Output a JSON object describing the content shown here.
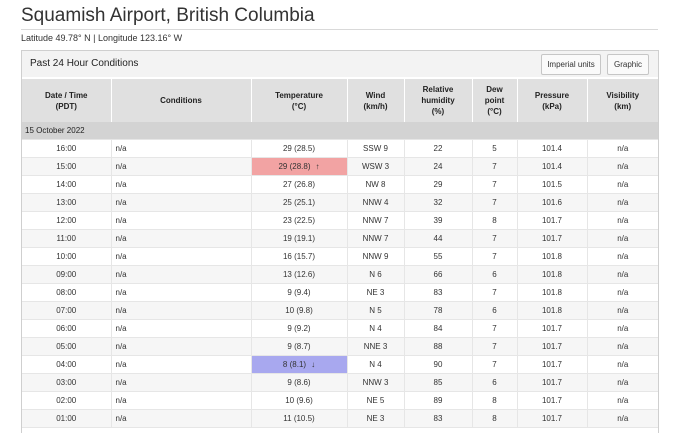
{
  "title": "Squamish Airport, British Columbia",
  "coordinates": "Latitude 49.78° N | Longitude 123.16° W",
  "panel": {
    "title": "Past 24 Hour Conditions",
    "imperial_button": "Imperial units",
    "graphic_button": "Graphic"
  },
  "columns": [
    {
      "key": "datetime",
      "lines": [
        "Date / Time",
        "(PDT)"
      ]
    },
    {
      "key": "conditions",
      "lines": [
        "Conditions"
      ]
    },
    {
      "key": "temperature",
      "lines": [
        "Temperature",
        "(°C)"
      ]
    },
    {
      "key": "wind",
      "lines": [
        "Wind",
        "(km/h)"
      ]
    },
    {
      "key": "humidity",
      "lines": [
        "Relative",
        "humidity",
        "(%)"
      ]
    },
    {
      "key": "dewpoint",
      "lines": [
        "Dew",
        "point",
        "(°C)"
      ]
    },
    {
      "key": "pressure",
      "lines": [
        "Pressure",
        "(kPa)"
      ]
    },
    {
      "key": "visibility",
      "lines": [
        "Visibility",
        "(km)"
      ]
    }
  ],
  "date_label": "15 October 2022",
  "highlight_colors": {
    "max": "#f2a3a3",
    "min": "#a8a8ef"
  },
  "icons": {
    "max": "arrow-up-icon",
    "min": "arrow-down-icon"
  },
  "rows": [
    {
      "time": "16:00",
      "conditions": "n/a",
      "temp": "29",
      "feels": "(28.5)",
      "wind": "SSW 9",
      "humidity": "22",
      "dewpoint": "5",
      "pressure": "101.4",
      "visibility": "n/a"
    },
    {
      "time": "15:00",
      "conditions": "n/a",
      "temp": "29",
      "feels": "(28.8)",
      "wind": "WSW 3",
      "humidity": "24",
      "dewpoint": "7",
      "pressure": "101.4",
      "visibility": "n/a",
      "flag": "max"
    },
    {
      "time": "14:00",
      "conditions": "n/a",
      "temp": "27",
      "feels": "(26.8)",
      "wind": "NW 8",
      "humidity": "29",
      "dewpoint": "7",
      "pressure": "101.5",
      "visibility": "n/a"
    },
    {
      "time": "13:00",
      "conditions": "n/a",
      "temp": "25",
      "feels": "(25.1)",
      "wind": "NNW 4",
      "humidity": "32",
      "dewpoint": "7",
      "pressure": "101.6",
      "visibility": "n/a"
    },
    {
      "time": "12:00",
      "conditions": "n/a",
      "temp": "23",
      "feels": "(22.5)",
      "wind": "NNW 7",
      "humidity": "39",
      "dewpoint": "8",
      "pressure": "101.7",
      "visibility": "n/a"
    },
    {
      "time": "11:00",
      "conditions": "n/a",
      "temp": "19",
      "feels": "(19.1)",
      "wind": "NNW 7",
      "humidity": "44",
      "dewpoint": "7",
      "pressure": "101.7",
      "visibility": "n/a"
    },
    {
      "time": "10:00",
      "conditions": "n/a",
      "temp": "16",
      "feels": "(15.7)",
      "wind": "NNW 9",
      "humidity": "55",
      "dewpoint": "7",
      "pressure": "101.8",
      "visibility": "n/a"
    },
    {
      "time": "09:00",
      "conditions": "n/a",
      "temp": "13",
      "feels": "(12.6)",
      "wind": "N 6",
      "humidity": "66",
      "dewpoint": "6",
      "pressure": "101.8",
      "visibility": "n/a"
    },
    {
      "time": "08:00",
      "conditions": "n/a",
      "temp": "9",
      "feels": "(9.4)",
      "wind": "NE 3",
      "humidity": "83",
      "dewpoint": "7",
      "pressure": "101.8",
      "visibility": "n/a"
    },
    {
      "time": "07:00",
      "conditions": "n/a",
      "temp": "10",
      "feels": "(9.8)",
      "wind": "N 5",
      "humidity": "78",
      "dewpoint": "6",
      "pressure": "101.8",
      "visibility": "n/a"
    },
    {
      "time": "06:00",
      "conditions": "n/a",
      "temp": "9",
      "feels": "(9.2)",
      "wind": "N 4",
      "humidity": "84",
      "dewpoint": "7",
      "pressure": "101.7",
      "visibility": "n/a"
    },
    {
      "time": "05:00",
      "conditions": "n/a",
      "temp": "9",
      "feels": "(8.7)",
      "wind": "NNE 3",
      "humidity": "88",
      "dewpoint": "7",
      "pressure": "101.7",
      "visibility": "n/a"
    },
    {
      "time": "04:00",
      "conditions": "n/a",
      "temp": "8",
      "feels": "(8.1)",
      "wind": "N 4",
      "humidity": "90",
      "dewpoint": "7",
      "pressure": "101.7",
      "visibility": "n/a",
      "flag": "min"
    },
    {
      "time": "03:00",
      "conditions": "n/a",
      "temp": "9",
      "feels": "(8.6)",
      "wind": "NNW 3",
      "humidity": "85",
      "dewpoint": "6",
      "pressure": "101.7",
      "visibility": "n/a"
    },
    {
      "time": "02:00",
      "conditions": "n/a",
      "temp": "10",
      "feels": "(9.6)",
      "wind": "NE 5",
      "humidity": "89",
      "dewpoint": "8",
      "pressure": "101.7",
      "visibility": "n/a"
    },
    {
      "time": "01:00",
      "conditions": "n/a",
      "temp": "11",
      "feels": "(10.5)",
      "wind": "NE 3",
      "humidity": "83",
      "dewpoint": "8",
      "pressure": "101.7",
      "visibility": "n/a"
    }
  ]
}
